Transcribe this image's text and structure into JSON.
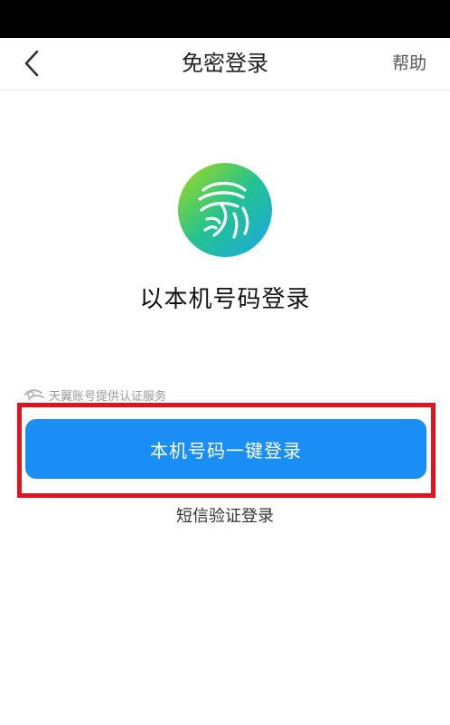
{
  "nav": {
    "back_icon": "chevron-left-icon",
    "title": "免密登录",
    "help_label": "帮助"
  },
  "logo": {
    "icon": "tianyi-fingerprint-logo-icon",
    "gradient_start": "#9fd81c",
    "gradient_mid": "#23c38f",
    "gradient_end": "#1aa6e6"
  },
  "main": {
    "heading": "以本机号码登录",
    "service_note": "天翼账号提供认证服务",
    "primary_button_label": "本机号码一键登录",
    "sms_login_label": "短信验证登录"
  },
  "colors": {
    "primary": "#1a8ef5",
    "highlight": "#e0141e"
  }
}
